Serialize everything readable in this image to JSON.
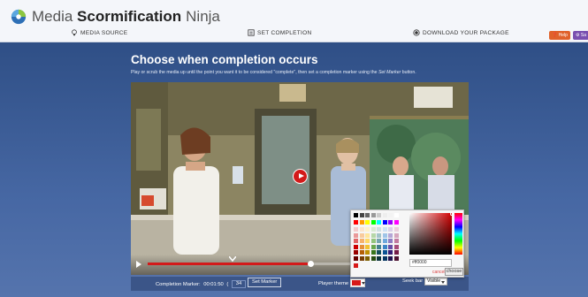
{
  "app": {
    "brand_primary": "Media",
    "brand_bold": "Scormification",
    "brand_secondary": "Ninja",
    "accent": "#3b5ba0"
  },
  "steps": [
    {
      "label": "MEDIA SOURCE",
      "icon": "lightbulb-icon"
    },
    {
      "label": "SET COMPLETION",
      "icon": "checklist-icon",
      "active": true
    },
    {
      "label": "DOWNLOAD YOUR PACKAGE",
      "icon": "record-icon"
    }
  ],
  "header_buttons": {
    "help_label": "Help",
    "help_color": "#e0622b",
    "second_label": "Sa",
    "second_color": "#7a4fb0"
  },
  "content": {
    "heading": "Choose when completion occurs",
    "subtext_before": "Play or scrub the media up until the point you want it to be considered \"complete\", then set a completion marker using the",
    "subtext_italic": "Set Marker",
    "subtext_after": "button."
  },
  "player": {
    "progress_percent": 34,
    "buffered_percent": 80
  },
  "completion": {
    "label": "Completion Marker:",
    "time": "00:01:50",
    "open_paren": "(",
    "percent": "34",
    "percent_suffix": "%)",
    "set_marker_label": "Set Marker"
  },
  "theme": {
    "label": "Player theme",
    "color": "#d71a1a"
  },
  "seek": {
    "label": "Seek bar",
    "value": "Visible"
  },
  "color_picker": {
    "hex_value": "#ff0000",
    "cancel_label": "cancel",
    "choose_label": "choose",
    "palette": [
      [
        "#000000",
        "#444444",
        "#666666",
        "#999999",
        "#cccccc",
        "#eeeeee",
        "#f3f3f3",
        "#ffffff"
      ],
      [
        "#ff0000",
        "#ff9900",
        "#ffff00",
        "#00ff00",
        "#00ffff",
        "#0000ff",
        "#9900ff",
        "#ff00ff"
      ],
      [
        "#f4cccc",
        "#fce5cd",
        "#fff2cc",
        "#d9ead3",
        "#d0e0e3",
        "#cfe2f3",
        "#d9d2e9",
        "#ead1dc"
      ],
      [
        "#ea9999",
        "#f9cb9c",
        "#ffe599",
        "#b6d7a8",
        "#a2c4c9",
        "#9fc5e8",
        "#b4a7d6",
        "#d5a6bd"
      ],
      [
        "#e06666",
        "#f6b26b",
        "#ffd966",
        "#93c47d",
        "#76a5af",
        "#6fa8dc",
        "#8e7cc3",
        "#c27ba0"
      ],
      [
        "#cc0000",
        "#e69138",
        "#f1c232",
        "#6aa84f",
        "#45818e",
        "#3d85c6",
        "#674ea7",
        "#a64d79"
      ],
      [
        "#990000",
        "#b45f06",
        "#bf9000",
        "#38761d",
        "#134f5c",
        "#0b5394",
        "#351c75",
        "#741b47"
      ],
      [
        "#660000",
        "#783f04",
        "#7f6000",
        "#274e13",
        "#0c343d",
        "#073763",
        "#20124d",
        "#4c1130"
      ]
    ],
    "recent": [
      "#d71a1a"
    ]
  }
}
